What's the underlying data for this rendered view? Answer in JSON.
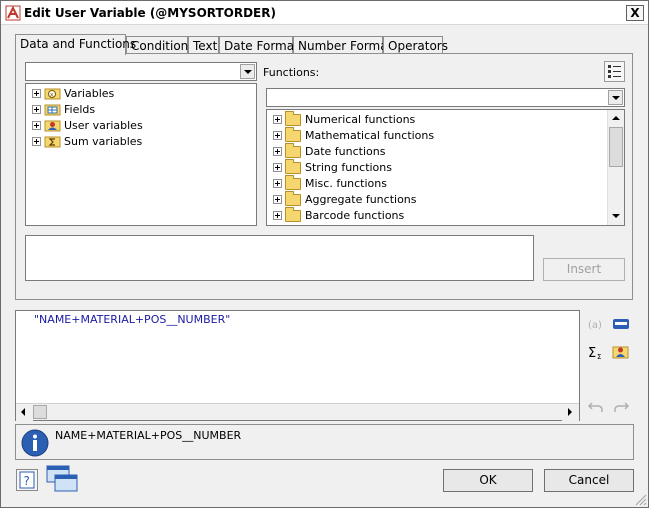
{
  "window": {
    "title": "Edit User Variable (@MYSORTORDER)",
    "close_label": "X"
  },
  "tabs": [
    {
      "label": "Data and Functions",
      "active": true
    },
    {
      "label": "Condition",
      "active": false
    },
    {
      "label": "Text",
      "active": false
    },
    {
      "label": "Date Format",
      "active": false
    },
    {
      "label": "Number Format",
      "active": false
    },
    {
      "label": "Operators",
      "active": false
    }
  ],
  "data_tree": {
    "combo_value": "",
    "items": [
      {
        "label": "Variables",
        "icon": "variables-icon"
      },
      {
        "label": "Fields",
        "icon": "fields-icon"
      },
      {
        "label": "User variables",
        "icon": "user-variables-icon"
      },
      {
        "label": "Sum variables",
        "icon": "sum-variables-icon"
      }
    ]
  },
  "functions": {
    "label": "Functions:",
    "combo_value": "",
    "items": [
      {
        "label": "Numerical functions"
      },
      {
        "label": "Mathematical functions"
      },
      {
        "label": "Date functions"
      },
      {
        "label": "String functions"
      },
      {
        "label": "Misc. functions"
      },
      {
        "label": "Aggregate functions"
      },
      {
        "label": "Barcode functions"
      }
    ]
  },
  "description_text": "",
  "insert_label": "Insert",
  "expression": {
    "value": "\"NAME+MATERIAL+POS__NUMBER\""
  },
  "info": {
    "text": "NAME+MATERIAL+POS__NUMBER"
  },
  "buttons": {
    "ok": "OK",
    "cancel": "Cancel"
  },
  "colors": {
    "expression_text": "#1a1aa6",
    "info_icon": "#2b5fb4",
    "folder": "#f6d66e"
  }
}
